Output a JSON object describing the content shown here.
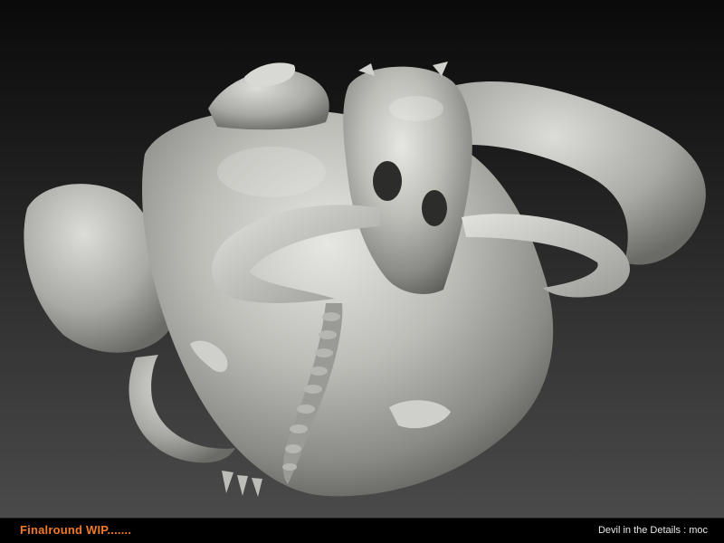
{
  "render": {
    "subject": "devil-sculpt-render",
    "background_top": "#0a0a0a",
    "background_bottom": "#4a4a4a",
    "clay_color": "#c8c8c4"
  },
  "caption": {
    "left_text": "Finalround WIP.......",
    "left_color": "#f07a2a",
    "right_text": "Devil in the Details  : moc",
    "right_color": "#e8e8e8"
  }
}
